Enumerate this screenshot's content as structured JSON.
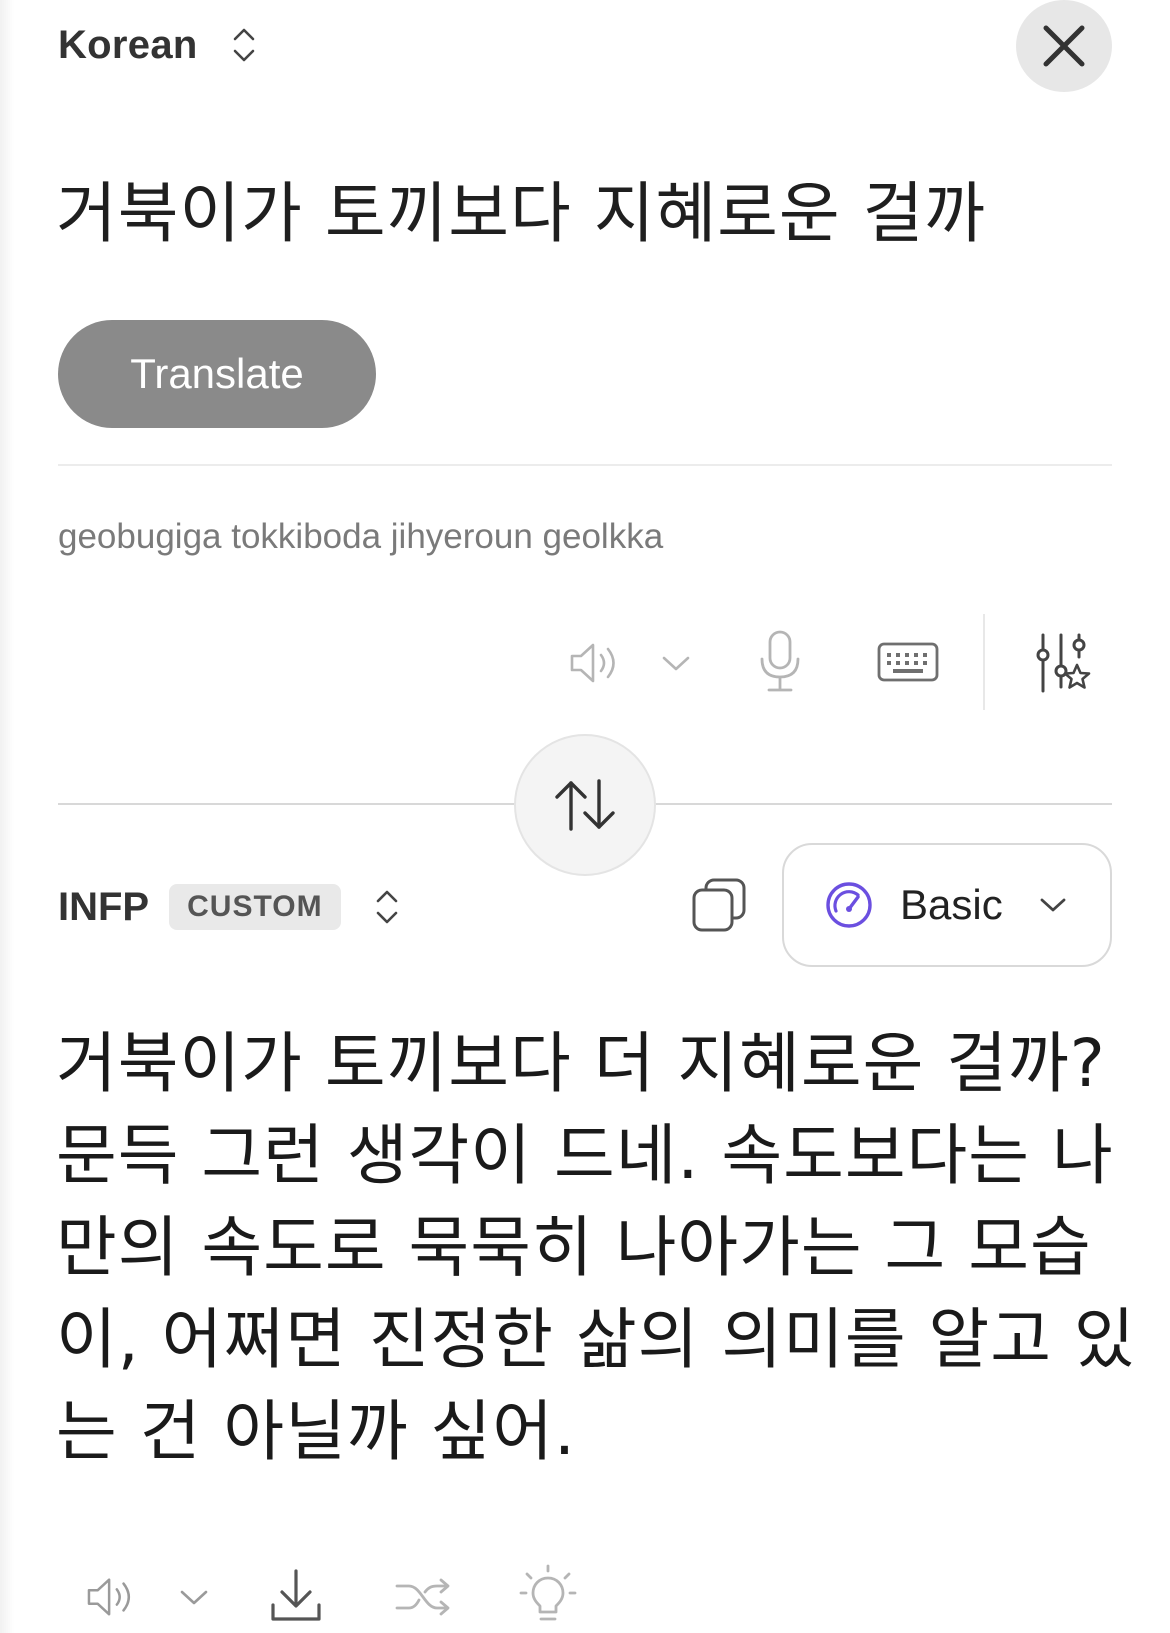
{
  "source": {
    "language": "Korean",
    "text": "거북이가 토끼보다 지혜로운 걸까",
    "romanization": "geobugiga tokkiboda jihyeroun geolkka"
  },
  "translate_button": {
    "label": "Translate"
  },
  "toolbar_icons": [
    "speaker-icon",
    "chevron-down-icon",
    "microphone-icon",
    "keyboard-icon",
    "sliders-star-icon"
  ],
  "target": {
    "language": "INFP",
    "badge": "CUSTOM",
    "mode": "Basic",
    "lines": [
      "거북이가 토끼보다 더 지혜로운 걸까?",
      "문득 그런 생각이 드네. 속도보다는 나",
      "만의 속도로 묵묵히 나아가는 그 모습",
      "이, 어쩌면 진정한 삶의 의미를 알고 있",
      "는 건 아닐까 싶어."
    ]
  },
  "bottom_icons": [
    "speaker-icon",
    "chevron-down-icon",
    "download-icon",
    "shuffle-icon",
    "lightbulb-icon"
  ],
  "colors": {
    "accent": "#6b4fe0",
    "translate_button": "#8a8a8a"
  }
}
